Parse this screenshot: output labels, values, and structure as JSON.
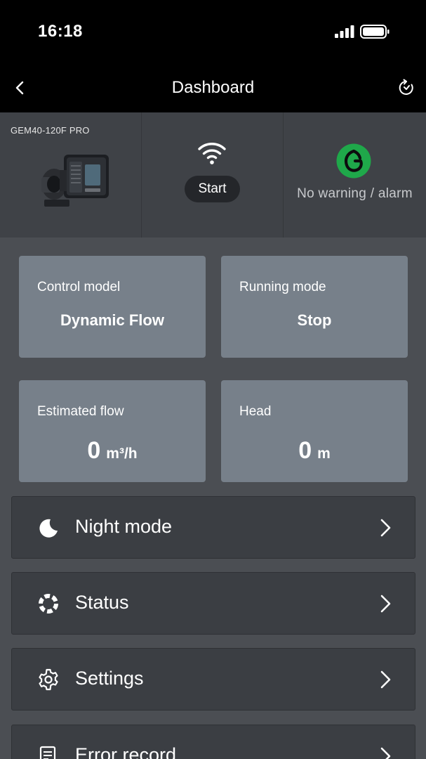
{
  "status_bar": {
    "time": "16:18"
  },
  "nav": {
    "title": "Dashboard"
  },
  "device": {
    "model": "GEM40-120F PRO",
    "connection_action": "Start",
    "alarm_status": "No warning / alarm"
  },
  "cards": {
    "control_model": {
      "label": "Control model",
      "value": "Dynamic Flow"
    },
    "running_mode": {
      "label": "Running mode",
      "value": "Stop"
    },
    "estimated_flow": {
      "label": "Estimated flow",
      "value": "0",
      "unit": "m³/h"
    },
    "head": {
      "label": "Head",
      "value": "0",
      "unit": "m"
    }
  },
  "menu": [
    {
      "label": "Night mode",
      "icon": "moon-icon"
    },
    {
      "label": "Status",
      "icon": "status-ring-icon"
    },
    {
      "label": "Settings",
      "icon": "gear-icon"
    },
    {
      "label": "Error record",
      "icon": "document-icon"
    }
  ],
  "colors": {
    "alarm_ok": "#1fa84a",
    "card": "#77808a",
    "row": "#3b3e43"
  }
}
